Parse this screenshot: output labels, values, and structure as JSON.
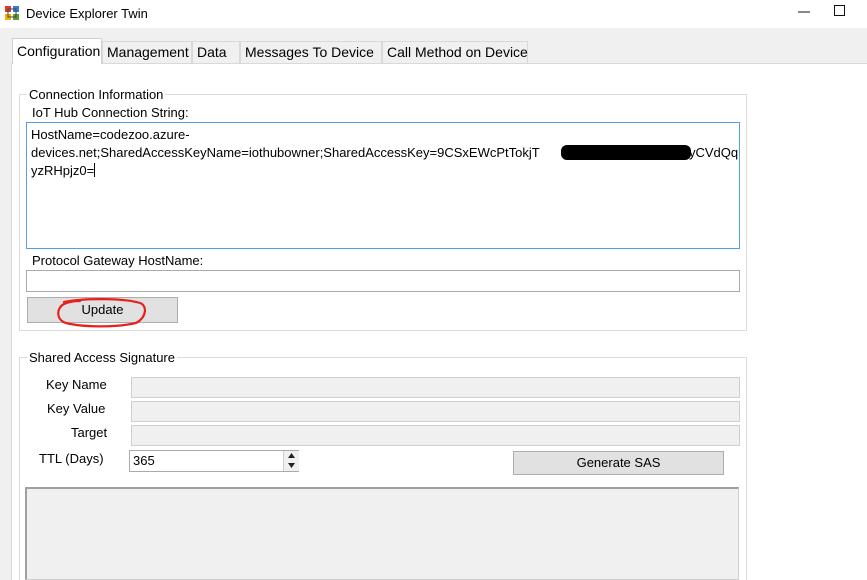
{
  "window": {
    "title": "Device Explorer Twin",
    "accent_color": "#569de5",
    "annotation_color": "#e8201c"
  },
  "tabs": [
    {
      "label": "Configuration",
      "active": true
    },
    {
      "label": "Management"
    },
    {
      "label": "Data"
    },
    {
      "label": "Messages To Device"
    },
    {
      "label": "Call Method on Device"
    }
  ],
  "connection": {
    "legend": "Connection Information",
    "conn_label": "IoT Hub Connection String:",
    "conn_line1": "HostName=codezoo.azure-",
    "conn_line2_a": "devices.net;SharedAccessKeyName=iothubowner;SharedAccessKey=9CSxEWcPtTokjT",
    "conn_line2_b": "yCVdQq",
    "conn_line3": "yzRHpjz0=",
    "gateway_label": "Protocol Gateway HostName:",
    "gateway_value": "",
    "update_label": "Update"
  },
  "sas": {
    "legend": "Shared Access Signature",
    "key_name_label": "Key Name",
    "key_value_label": "Key Value",
    "target_label": "Target",
    "ttl_label": "TTL (Days)",
    "ttl_value": "365",
    "generate_label": "Generate SAS"
  }
}
